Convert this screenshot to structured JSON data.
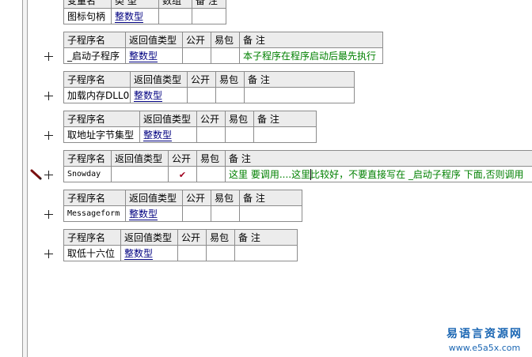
{
  "var_table": {
    "headers": [
      "变量名",
      "类 型",
      "数组",
      "备 注"
    ],
    "row": [
      "图标句柄",
      "整数型",
      "",
      ""
    ]
  },
  "subroutines": [
    {
      "headers": [
        "子程序名",
        "返回值类型",
        "公开",
        "易包",
        "备 注"
      ],
      "name": "_启动子程序",
      "return_type": "整数型",
      "public": "",
      "easy_pkg": "",
      "note": "本子程序在程序启动后最先执行"
    },
    {
      "headers": [
        "子程序名",
        "返回值类型",
        "公开",
        "易包",
        "备 注"
      ],
      "name": "加载内存DLL0",
      "return_type": "整数型",
      "public": "",
      "easy_pkg": "",
      "note": ""
    },
    {
      "headers": [
        "子程序名",
        "返回值类型",
        "公开",
        "易包",
        "备 注"
      ],
      "name": "取地址字节集型",
      "return_type": "整数型",
      "public": "",
      "easy_pkg": "",
      "note": ""
    },
    {
      "headers": [
        "子程序名",
        "返回值类型",
        "公开",
        "易包",
        "备 注"
      ],
      "name": "Snowday",
      "return_type": "",
      "public": "✔",
      "easy_pkg": "",
      "note": "这里 要调用....这里比较好，不要直接写在 _启动子程序 下面,否则调用"
    },
    {
      "headers": [
        "子程序名",
        "返回值类型",
        "公开",
        "易包",
        "备 注"
      ],
      "name": "Messageform",
      "return_type": "整数型",
      "public": "",
      "easy_pkg": "",
      "note": ""
    },
    {
      "headers": [
        "子程序名",
        "返回值类型",
        "公开",
        "易包",
        "备 注"
      ],
      "name": "取低十六位",
      "return_type": "整数型",
      "public": "",
      "easy_pkg": "",
      "note": ""
    }
  ],
  "icons": {
    "expand": "plus-icon",
    "marker": "pencil-marker-icon",
    "check": "checkmark-icon"
  },
  "colors": {
    "type_text": "#000080",
    "note_text": "#008000",
    "check": "#a0001e",
    "watermark": "#1a66b3"
  },
  "watermark": {
    "title": "易语言资源网",
    "url": "www.e5a5x.com"
  }
}
